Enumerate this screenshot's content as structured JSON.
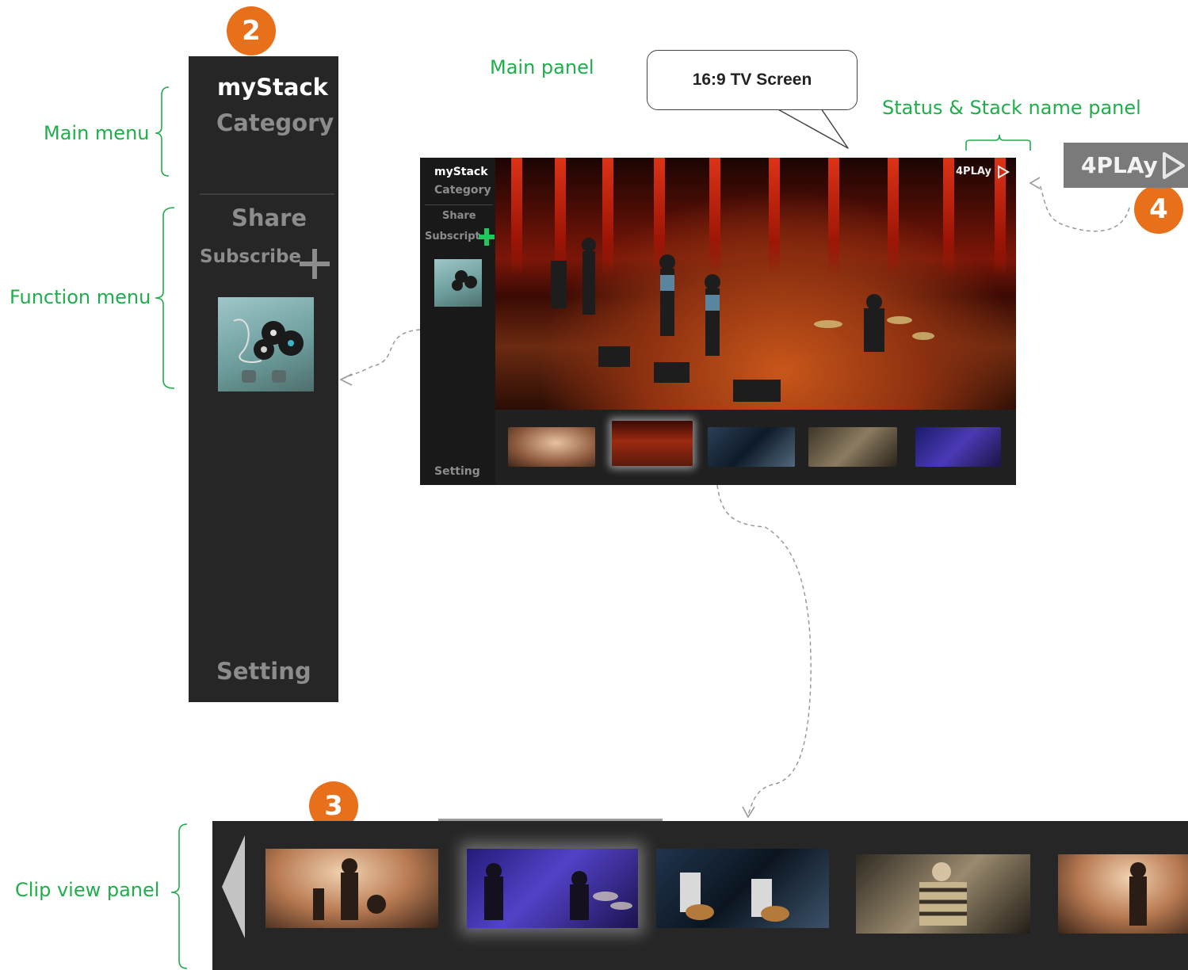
{
  "labels": {
    "main_menu": "Main menu",
    "function_menu": "Function menu",
    "main_panel": "Main panel",
    "status_panel": "Status & Stack name panel",
    "clip_view_panel": "Clip view panel"
  },
  "badges": {
    "b2": "2",
    "b3": "3",
    "b4": "4"
  },
  "callout": {
    "text": "16:9 TV Screen"
  },
  "sidebar": {
    "mystack": "myStack",
    "category": "Category",
    "share": "Share",
    "subscribe": "Subscribe",
    "setting": "Setting"
  },
  "tv": {
    "mystack": "myStack",
    "category": "Category",
    "share": "Share",
    "subscript": "Subscript",
    "setting": "Setting",
    "logo": "4PLAy"
  },
  "logo": {
    "text": "4PLAy"
  },
  "colors": {
    "annotation_green": "#1fae4b",
    "badge_orange": "#e8701a",
    "panel_dark": "#262626",
    "plus_green": "#22c55e"
  }
}
